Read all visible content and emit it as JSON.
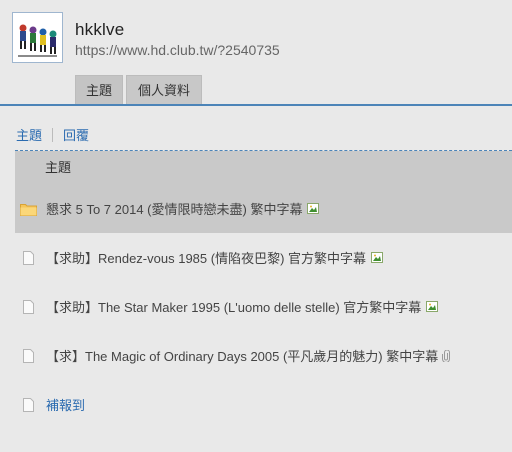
{
  "profile": {
    "username": "hkklve",
    "url": "https://www.hd.club.tw/?2540735"
  },
  "tabs": [
    {
      "label": "主題",
      "active": true
    },
    {
      "label": "個人資料",
      "active": false
    }
  ],
  "subnav": {
    "topics": "主題",
    "replies": "回覆"
  },
  "list": {
    "header": "主題",
    "rows": [
      {
        "title": "懇求 5 To 7 2014 (愛情限時戀未盡) 繁中字幕",
        "icon": "folder-icon",
        "attachment": "image-icon"
      },
      {
        "title": "【求助】Rendez-vous 1985 (情陷夜巴黎) 官方繁中字幕",
        "icon": "document-icon",
        "attachment": "image-icon"
      },
      {
        "title": "【求助】The Star Maker 1995 (L'uomo delle stelle) 官方繁中字幕",
        "icon": "document-icon",
        "attachment": "image-icon"
      },
      {
        "title": "【求】The Magic of Ordinary Days 2005 (平凡歲月的魅力) 繁中字幕",
        "icon": "document-icon",
        "attachment": "paperclip-icon"
      },
      {
        "title": "補報到",
        "icon": "document-icon",
        "attachment": ""
      }
    ]
  },
  "colors": {
    "accent": "#4c84b8",
    "link": "#2b6bb0",
    "highlight": "#c9c9c9",
    "background": "#e9e9e9"
  }
}
